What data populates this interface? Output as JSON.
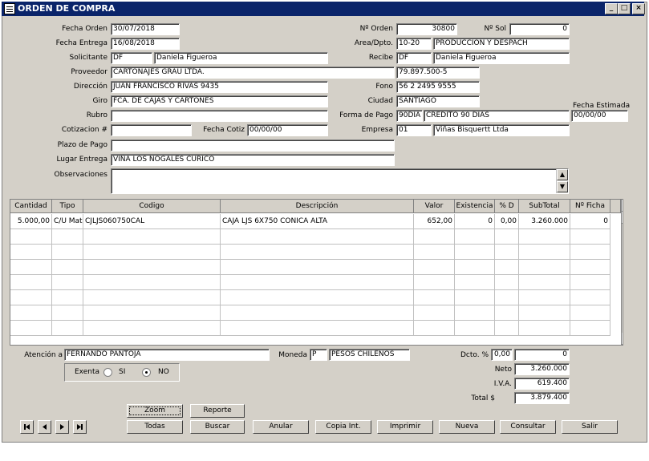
{
  "window": {
    "title": "ORDEN DE COMPRA",
    "minimize": "_",
    "maximize": "□",
    "close": "×"
  },
  "form": {
    "fecha_orden": {
      "label": "Fecha Orden",
      "value": "30/07/2018"
    },
    "fecha_entrega": {
      "label": "Fecha Entrega",
      "value": "16/08/2018"
    },
    "solicitante": {
      "label": "Solicitante",
      "code": "DF",
      "name": "Daniela Figueroa"
    },
    "proveedor": {
      "label": "Proveedor",
      "value": "CARTONAJES GRAU LTDA.",
      "rut": "79.897.500-5"
    },
    "direccion": {
      "label": "Dirección",
      "value": "JUAN FRANCISCO RIVAS 9435"
    },
    "giro": {
      "label": "Giro",
      "value": "FCA. DE CAJAS Y CARTONES"
    },
    "rubro": {
      "label": "Rubro",
      "value": ""
    },
    "cotizacion": {
      "label": "Cotizacion #",
      "value": ""
    },
    "fecha_cotiz": {
      "label": "Fecha Cotiz",
      "value": "00/00/00"
    },
    "plazo_pago": {
      "label": "Plazo de Pago",
      "value": ""
    },
    "lugar_entrega": {
      "label": "Lugar Entrega",
      "value": "VIÑA LOS NOGALES CURICO"
    },
    "observaciones": {
      "label": "Observaciones",
      "value": ""
    },
    "n_orden": {
      "label": "Nº Orden",
      "value": "30800"
    },
    "n_sol": {
      "label": "Nº Sol",
      "value": "0"
    },
    "area": {
      "label": "Area/Dpto.",
      "code": "10-20",
      "name": "PRODUCCION Y DESPACH"
    },
    "recibe": {
      "label": "Recibe",
      "code": "DF",
      "name": "Daniela Figueroa"
    },
    "fono": {
      "label": "Fono",
      "value": "56 2 2495 9555"
    },
    "ciudad": {
      "label": "Ciudad",
      "value": "SANTIAGO"
    },
    "forma_pago": {
      "label": "Forma de Pago",
      "code": "90DIA",
      "name": "CREDITO 90 DIAS"
    },
    "empresa": {
      "label": "Empresa",
      "code": "01",
      "name": "Viñas Bisquertt Ltda"
    },
    "fecha_estimada": {
      "label": "Fecha Estimada",
      "value": "00/00/00"
    }
  },
  "grid": {
    "headers": [
      "Cantidad",
      "Tipo",
      "Codigo",
      "Descripción",
      "Valor",
      "Existencia",
      "% D",
      "SubTotal",
      "Nº Ficha"
    ],
    "rows": [
      [
        "5.000,00",
        "C/U Mat",
        "CJLJS060750CAL",
        "CAJA LJS 6X750 CONICA ALTA",
        "652,00",
        "0",
        "0,00",
        "3.260.000",
        "0"
      ],
      [
        "",
        "",
        "",
        "",
        "",
        "",
        "",
        "",
        ""
      ],
      [
        "",
        "",
        "",
        "",
        "",
        "",
        "",
        "",
        ""
      ],
      [
        "",
        "",
        "",
        "",
        "",
        "",
        "",
        "",
        ""
      ],
      [
        "",
        "",
        "",
        "",
        "",
        "",
        "",
        "",
        ""
      ],
      [
        "",
        "",
        "",
        "",
        "",
        "",
        "",
        "",
        ""
      ],
      [
        "",
        "",
        "",
        "",
        "",
        "",
        "",
        "",
        ""
      ],
      [
        "",
        "",
        "",
        "",
        "",
        "",
        "",
        "",
        ""
      ]
    ]
  },
  "footer": {
    "atencion": {
      "label": "Atención a",
      "value": "FERNANDO PANTOJA"
    },
    "moneda": {
      "label": "Moneda",
      "code": "P",
      "name": "PESOS CHILENOS"
    },
    "exenta": {
      "label": "Exenta",
      "si": "SI",
      "no": "NO",
      "selected": "NO"
    },
    "dcto": {
      "label": "Dcto. %",
      "pct": "0,00",
      "value": "0"
    },
    "neto": {
      "label": "Neto",
      "value": "3.260.000"
    },
    "iva": {
      "label": "I.V.A.",
      "value": "619.400"
    },
    "total": {
      "label": "Total $",
      "value": "3.879.400"
    }
  },
  "buttons": {
    "zoom": "Zoom",
    "reporte": "Reporte",
    "todas": "Todas",
    "buscar": "Buscar",
    "anular": "Anular",
    "copia": "Copia Int.",
    "imprimir": "Imprimir",
    "nueva": "Nueva",
    "consultar": "Consultar",
    "salir": "Salir"
  },
  "colors": {
    "titlebar": "#0a246a",
    "face": "#d4d0c8"
  }
}
